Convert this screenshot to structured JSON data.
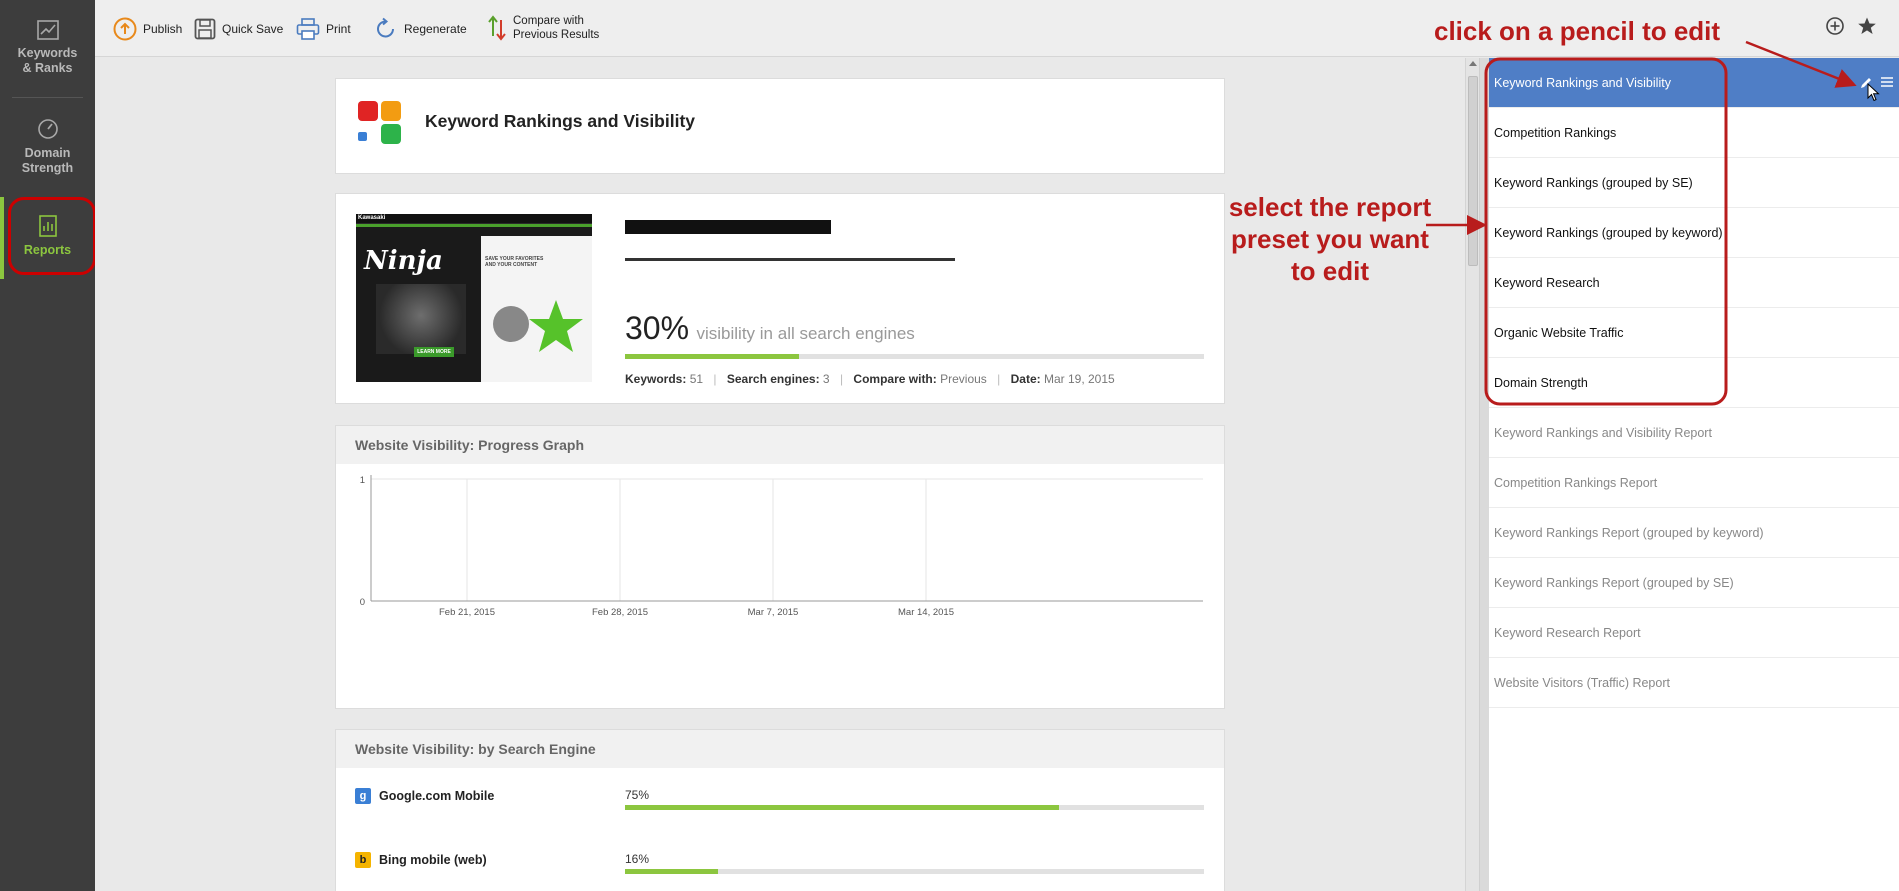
{
  "nav": {
    "items": [
      {
        "label_line1": "Keywords",
        "label_line2": "& Ranks"
      },
      {
        "label_line1": "Domain",
        "label_line2": "Strength"
      },
      {
        "label_line1": "Reports"
      }
    ]
  },
  "toolbar": {
    "publish": "Publish",
    "quick_save": "Quick Save",
    "print": "Print",
    "regenerate": "Regenerate",
    "compare_line1": "Compare with",
    "compare_line2": "Previous Results"
  },
  "report": {
    "title": "Keyword Rankings and Visibility",
    "visibility_percent": "30%",
    "visibility_text": "visibility in all search engines",
    "visibility_fill": 0.3,
    "keywords_label": "Keywords:",
    "keywords_value": "51",
    "engines_label": "Search engines:",
    "engines_value": "3",
    "compare_label": "Compare with:",
    "compare_value": "Previous",
    "date_label": "Date:",
    "date_value": "Mar 19, 2015",
    "thumbnail": {
      "brand": "Kawasaki",
      "model": "Ninja",
      "button": "LEARN MORE",
      "side_text": "SAVE YOUR FAVORITES AND YOUR CONTENT"
    }
  },
  "progress_graph": {
    "title": "Website Visibility: Progress Graph"
  },
  "chart_data": {
    "type": "line",
    "title": "Website Visibility: Progress Graph",
    "categories": [
      "Feb 21, 2015",
      "Feb 28, 2015",
      "Mar 7, 2015",
      "Mar 14, 2015"
    ],
    "series": [],
    "ylim": [
      0,
      1
    ],
    "yticks": [
      "1",
      "0"
    ],
    "grid": true
  },
  "by_engine": {
    "title": "Website Visibility: by Search Engine",
    "engines": [
      {
        "name": "Google.com Mobile",
        "percent_label": "75%",
        "fill": 0.75,
        "icon": "google-icon"
      },
      {
        "name": "Bing mobile (web)",
        "percent_label": "16%",
        "fill": 0.16,
        "icon": "bing-icon"
      }
    ]
  },
  "presets": {
    "items": [
      {
        "label": "Keyword Rankings and Visibility"
      },
      {
        "label": "Competition Rankings"
      },
      {
        "label": "Keyword Rankings (grouped by SE)"
      },
      {
        "label": "Keyword Rankings (grouped by keyword)"
      },
      {
        "label": "Keyword Research"
      },
      {
        "label": "Organic Website Traffic"
      },
      {
        "label": "Domain Strength"
      }
    ],
    "templates": [
      {
        "label": "Keyword Rankings and Visibility Report"
      },
      {
        "label": "Competition Rankings Report"
      },
      {
        "label": "Keyword Rankings Report (grouped by keyword)"
      },
      {
        "label": "Keyword Rankings Report (grouped by SE)"
      },
      {
        "label": "Keyword Research Report"
      },
      {
        "label": "Website Visitors (Traffic) Report"
      }
    ]
  },
  "annotations": {
    "pencil": "click on a pencil to edit",
    "select_line1": "select the report",
    "select_line2": "preset you want",
    "select_line3": "to edit"
  },
  "colors": {
    "accent_green": "#8cc63f",
    "selected_blue": "#4f7ec6",
    "annotation_red": "#b81c1c"
  }
}
